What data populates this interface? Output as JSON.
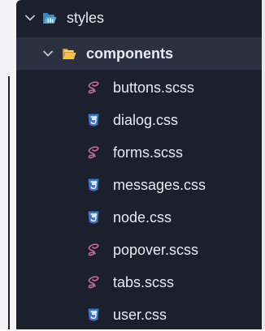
{
  "explorer": {
    "root_folder": {
      "name": "styles",
      "icon": "folder-open-blue-icon",
      "expanded": true
    },
    "sub_folder": {
      "name": "components",
      "icon": "folder-open-yellow-icon",
      "expanded": true,
      "selected": true
    },
    "files": [
      {
        "name": "buttons.scss",
        "icon": "sass-icon"
      },
      {
        "name": "dialog.css",
        "icon": "css3-icon"
      },
      {
        "name": "forms.scss",
        "icon": "sass-icon"
      },
      {
        "name": "messages.css",
        "icon": "css3-icon"
      },
      {
        "name": "node.css",
        "icon": "css3-icon"
      },
      {
        "name": "popover.scss",
        "icon": "sass-icon"
      },
      {
        "name": "tabs.scss",
        "icon": "sass-icon"
      },
      {
        "name": "user.css",
        "icon": "css3-icon"
      }
    ]
  },
  "colors": {
    "panel_background": "#1c1f2c",
    "selected_row": "#2c3142",
    "text": "#e8eaf2",
    "sass_pink": "#c96a97",
    "css3_blue": "#3d74c9",
    "folder_blue": "#5aa5d6",
    "folder_yellow": "#f0c14b"
  }
}
